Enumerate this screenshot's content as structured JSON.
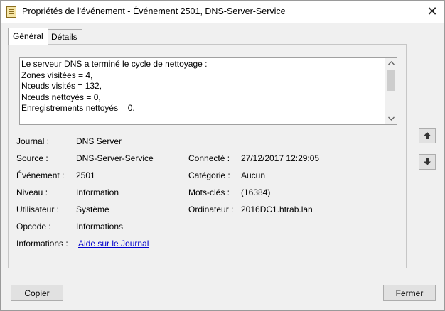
{
  "window": {
    "title": "Propriétés de l'événement - Événement 2501, DNS-Server-Service",
    "close_symbol": "✕"
  },
  "tabs": [
    {
      "label": "Général",
      "active": true
    },
    {
      "label": "Détails",
      "active": false
    }
  ],
  "description": {
    "text": "Le serveur DNS a terminé le cycle de nettoyage :\nZones visitées = 4,\nNœuds visités = 132,\nNœuds nettoyés = 0,\nEnregistrements nettoyés = 0."
  },
  "details": {
    "journal_label": "Journal :",
    "journal_value": "DNS Server",
    "source_label": "Source :",
    "source_value": "DNS-Server-Service",
    "connecte_label": "Connecté :",
    "connecte_value": "27/12/2017 12:29:05",
    "evenement_label": "Événement :",
    "evenement_value": "2501",
    "categorie_label": "Catégorie :",
    "categorie_value": "Aucun",
    "niveau_label": "Niveau :",
    "niveau_value": "Information",
    "motscles_label": "Mots-clés :",
    "motscles_value": "(16384)",
    "utilisateur_label": "Utilisateur :",
    "utilisateur_value": "Système",
    "ordinateur_label": "Ordinateur :",
    "ordinateur_value": "2016DC1.htrab.lan",
    "opcode_label": "Opcode :",
    "opcode_value": "Informations",
    "informations_label": "Informations :",
    "informations_link": "Aide sur le Journal"
  },
  "buttons": {
    "copy": "Copier",
    "close": "Fermer"
  },
  "icons": {
    "previous": "arrow-up-icon",
    "next": "arrow-down-icon"
  }
}
